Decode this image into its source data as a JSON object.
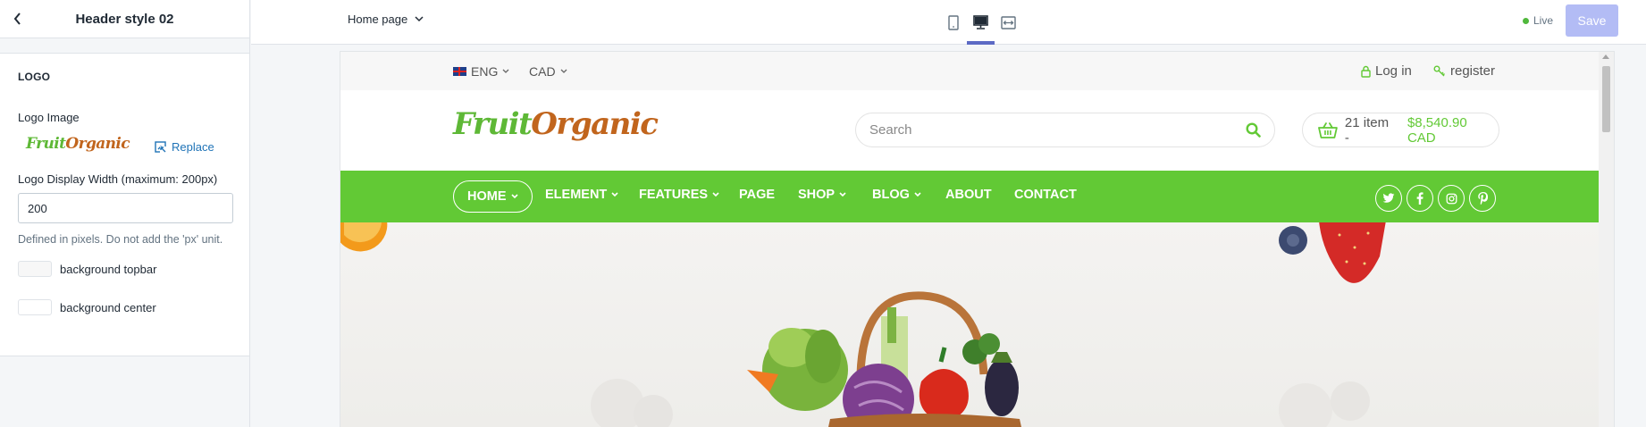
{
  "sidebar": {
    "title": "Header style 02",
    "section_title": "LOGO",
    "logo_image_label": "Logo Image",
    "logo_green": "Fruit",
    "logo_orange": "Organic",
    "replace_label": "Replace",
    "width_label": "Logo Display Width (maximum: 200px)",
    "width_value": "200",
    "help_text": "Defined in pixels. Do not add the 'px' unit.",
    "bg_topbar_label": "background topbar",
    "bg_center_label": "background center"
  },
  "topbar": {
    "page_select": "Home page",
    "devices": [
      "mobile-icon",
      "desktop-icon",
      "fullwidth-icon"
    ],
    "active_device": "desktop",
    "live_label": "Live",
    "save_label": "Save"
  },
  "site": {
    "language": "ENG",
    "currency": "CAD",
    "login_label": "Log in",
    "register_label": "register",
    "logo_green": "Fruit",
    "logo_orange": "Organic",
    "search_placeholder": "Search",
    "cart_items": "21 item -",
    "cart_total": "$8,540.90 CAD",
    "nav": [
      "HOME",
      "ELEMENT",
      "FEATURES",
      "PAGE",
      "SHOP",
      "BLOG",
      "ABOUT",
      "CONTACT"
    ],
    "social": [
      "twitter-icon",
      "facebook-icon",
      "instagram-icon",
      "pinterest-icon"
    ]
  },
  "colors": {
    "brand_green": "#62c935",
    "logo_orange": "#c1651d",
    "link_blue": "#1f73b7",
    "save_disabled": "#b3bcf5",
    "device_active": "#5c6ac4"
  }
}
